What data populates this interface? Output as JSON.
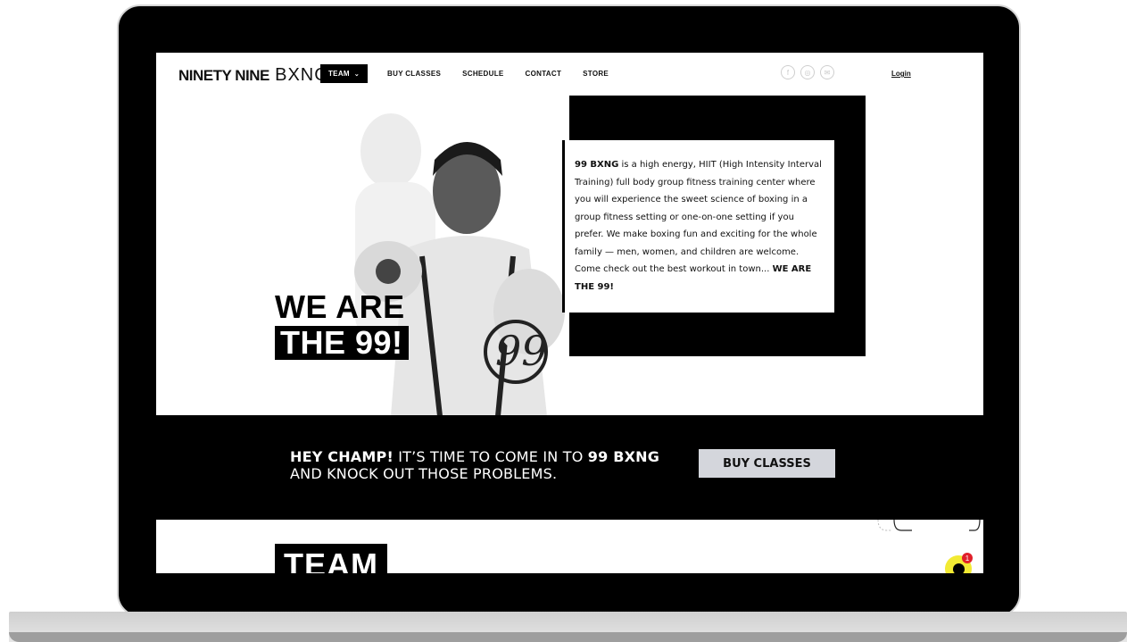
{
  "nav": {
    "logo_bold": "NINETY NINE",
    "logo_light": "BXNG",
    "items": [
      {
        "label": "TEAM",
        "has_dropdown": true,
        "active": true
      },
      {
        "label": "BUY CLASSES"
      },
      {
        "label": "SCHEDULE"
      },
      {
        "label": "CONTACT"
      },
      {
        "label": "STORE"
      }
    ],
    "social_icons": [
      "facebook-icon",
      "instagram-icon",
      "yelp-icon"
    ],
    "social_glyphs": [
      "f",
      "◎",
      "✉"
    ],
    "login_label": "Login"
  },
  "hero": {
    "headline_line1": "WE ARE",
    "headline_line2": "THE 99!",
    "about_brand": "99 BXNG",
    "about_text": " is a high energy, HIIT (High Intensity Interval Training) full body group fitness training center where you will experience the sweet science of boxing in a group fitness setting or one-on-one setting if you prefer. We make boxing fun and exciting for the whole family — men, women, and children are welcome. Come check out the best workout in town... ",
    "about_tagline": "WE ARE THE 99!"
  },
  "cta": {
    "lead_bold": "HEY CHAMP!",
    "lead_rest": " IT’S TIME TO COME IN TO ",
    "lead_brand": "99 BXNG",
    "line2": "AND KNOCK OUT THOSE PROBLEMS.",
    "button_label": "BUY CLASSES"
  },
  "team": {
    "title": "TEAM"
  },
  "chat": {
    "badge_count": "1",
    "accent": "#f2ea33",
    "badge_color": "#e0202a"
  },
  "colors": {
    "primary": "#000000",
    "background": "#ffffff",
    "button": "#d4d6dc"
  }
}
